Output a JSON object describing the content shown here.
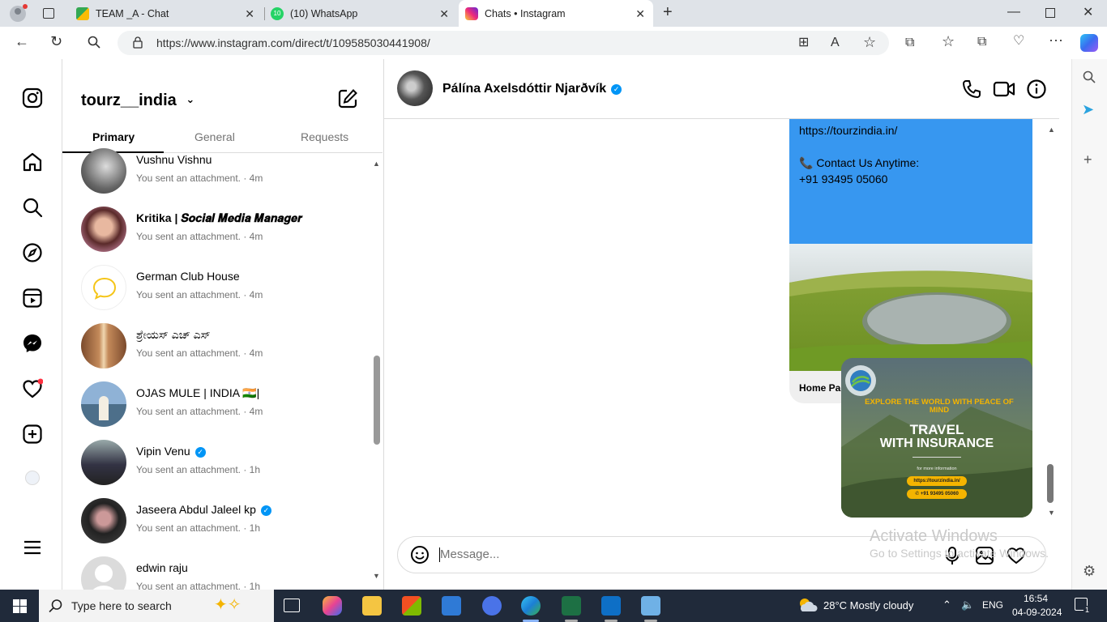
{
  "browser": {
    "tabs": [
      {
        "title": "TEAM _A - Chat"
      },
      {
        "title": "(10) WhatsApp"
      },
      {
        "title": "Chats • Instagram"
      }
    ],
    "url": "https://www.instagram.com/direct/t/109585030441908/"
  },
  "instagram": {
    "username": "tourz__india",
    "tabs": [
      "Primary",
      "General",
      "Requests"
    ],
    "conversations": [
      {
        "name": "Vushnu Vishnu",
        "sub": "You sent an attachment. · 4m",
        "verified": false
      },
      {
        "name": "Kritika | 𝑺𝒐𝒄𝒊𝒂𝒍 𝑴𝒆𝒅𝒊𝒂 𝑴𝒂𝒏𝒂𝒈𝒆𝒓",
        "sub": "You sent an attachment. · 4m",
        "verified": false
      },
      {
        "name": "German Club House",
        "sub": "You sent an attachment. · 4m",
        "verified": false
      },
      {
        "name": "ಶ್ರೇಯಸ್ ಎಚ್ ಎಸ್",
        "sub": "You sent an attachment. · 4m",
        "verified": false
      },
      {
        "name": "OJAS MULE | INDIA 🇮🇳|",
        "sub": "You sent an attachment. · 4m",
        "verified": false
      },
      {
        "name": "Vipin Venu",
        "sub": "You sent an attachment. · 1h",
        "verified": true
      },
      {
        "name": "Jaseera Abdul Jaleel kp",
        "sub": "You sent an attachment. · 1h",
        "verified": true
      },
      {
        "name": "edwin raju",
        "sub": "You sent an attachment. · 1h",
        "verified": false
      }
    ],
    "chat": {
      "contact_name": "Pálína Axelsdóttir Njarðvík",
      "message_lines": [
        "https://tourzindia.in/",
        "",
        "📞 Contact Us Anytime:",
        "+91 93495 05060"
      ],
      "link_preview_title": "Home Page",
      "poster": {
        "headline": "EXPLORE THE WORLD WITH PEACE OF MIND",
        "title_line1": "TRAVEL",
        "title_line2": "WITH INSURANCE",
        "small": "for more information",
        "link": "https://tourzindia.in/",
        "phone": "✆ +91 93495 05060"
      },
      "composer_placeholder": "Message..."
    }
  },
  "watermark": {
    "line1": "Activate Windows",
    "line2": "Go to Settings to activate Windows."
  },
  "taskbar": {
    "search_placeholder": "Type here to search",
    "weather": "28°C  Mostly cloudy",
    "language": "ENG",
    "time": "16:54",
    "date": "04-09-2024",
    "notification_count": "1"
  }
}
